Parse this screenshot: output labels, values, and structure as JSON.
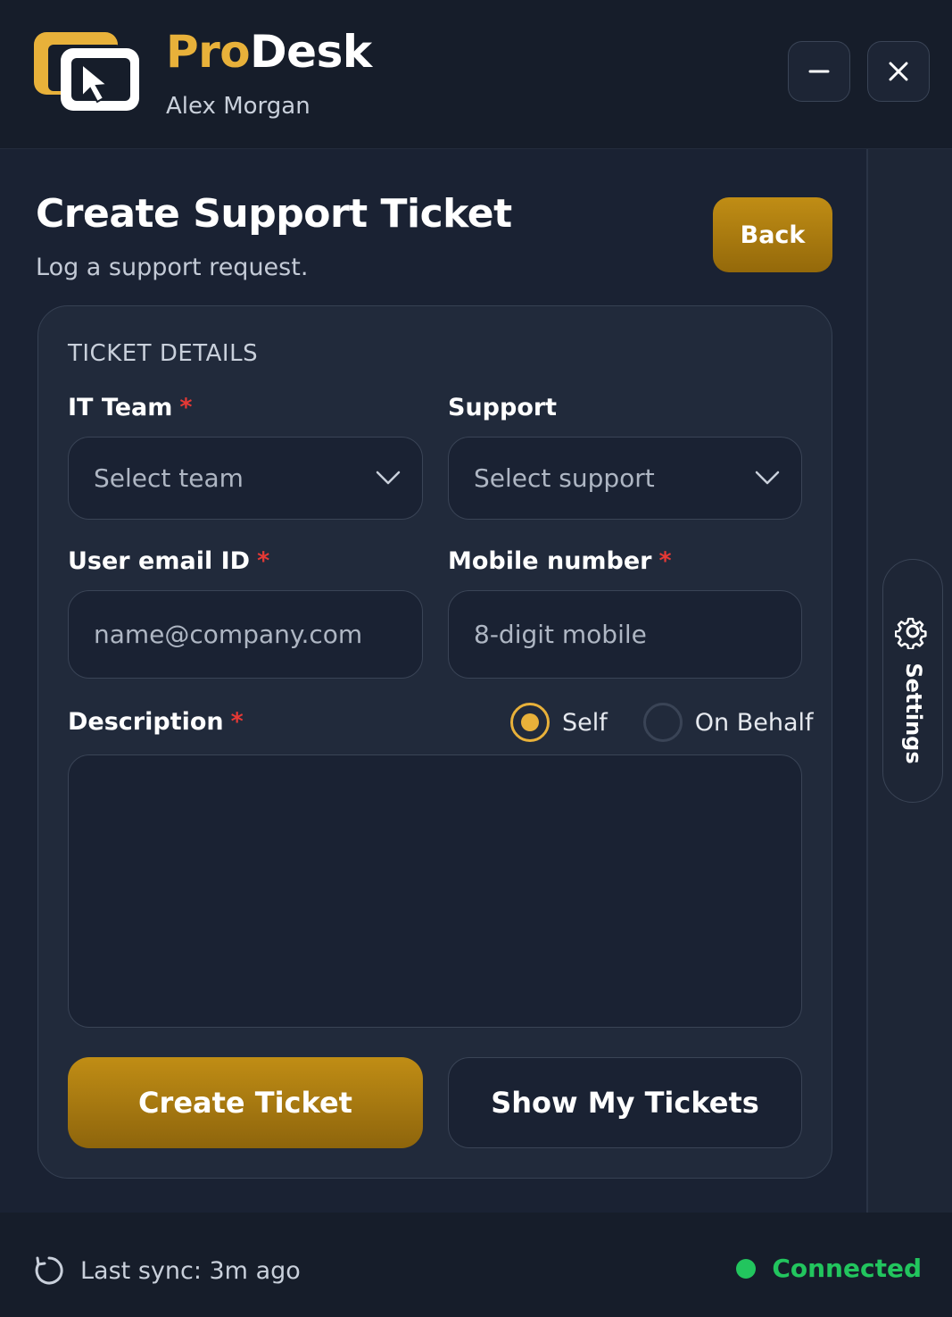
{
  "app": {
    "brand_part1": "Pro",
    "brand_part2": "Desk",
    "user_name": "Alex Morgan",
    "accent_color": "#e8b13a"
  },
  "window_controls": {
    "minimize_icon": "minus-icon",
    "close_icon": "close-icon"
  },
  "page": {
    "title": "Create Support Ticket",
    "subtitle": "Log a support request.",
    "back_label": "Back"
  },
  "form": {
    "section_title": "TICKET DETAILS",
    "required_marker": "*",
    "it_team": {
      "label": "IT Team",
      "placeholder": "Select team"
    },
    "support": {
      "label": "Support",
      "placeholder": "Select support"
    },
    "email": {
      "label": "User email ID",
      "placeholder": "name@company.com"
    },
    "mobile": {
      "label": "Mobile number",
      "placeholder": "8-digit mobile"
    },
    "description": {
      "label": "Description",
      "value": ""
    },
    "request_for": {
      "options": [
        "Self",
        "On Behalf"
      ],
      "selected": "Self"
    },
    "create_label": "Create Ticket",
    "show_tickets_label": "Show My Tickets"
  },
  "sidebar": {
    "settings_label": "Settings",
    "settings_icon": "gear-icon"
  },
  "footer": {
    "sync_text": "Last sync: 3m ago",
    "status_text": "Connected",
    "status_color": "#22c55e"
  }
}
